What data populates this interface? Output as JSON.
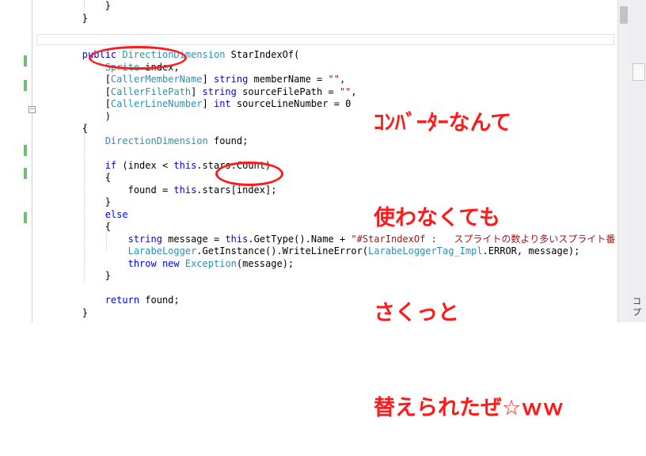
{
  "code_lines": [
    "            }",
    "        }",
    "",
    "",
    "        public DirectionDimension StarIndexOf(",
    "            Sprite index,",
    "            [CallerMemberName] string memberName = \"\",",
    "            [CallerFilePath] string sourceFilePath = \"\",",
    "            [CallerLineNumber] int sourceLineNumber = 0",
    "            )",
    "        {",
    "            DirectionDimension found;",
    "",
    "            if (index < this.stars.Count)",
    "            {",
    "                found = this.stars[index];",
    "            }",
    "            else",
    "            {",
    "                string message = this.GetType().Name + \"#StarIndexOf :   スプライトの数より多いスプライト番",
    "                LarabeLogger.GetInstance().WriteLineError(LarabeLoggerTag_Impl.ERROR, message);",
    "                throw new Exception(message);",
    "            }",
    "",
    "            return found;",
    "        }"
  ],
  "annotation": {
    "lines": [
      "ｺﾝﾊﾞｰﾀｰなんて",
      "使わなくても",
      "さくっと",
      "替えられたぜ☆ｗｗ"
    ],
    "color": "#ff1a1a"
  },
  "side_panel": {
    "text_lines": [
      "コ",
      "プ"
    ]
  },
  "colors": {
    "keyword": "#0000ff",
    "type": "#2b91af",
    "string": "#a31515",
    "change_bar": "#6cc070"
  }
}
